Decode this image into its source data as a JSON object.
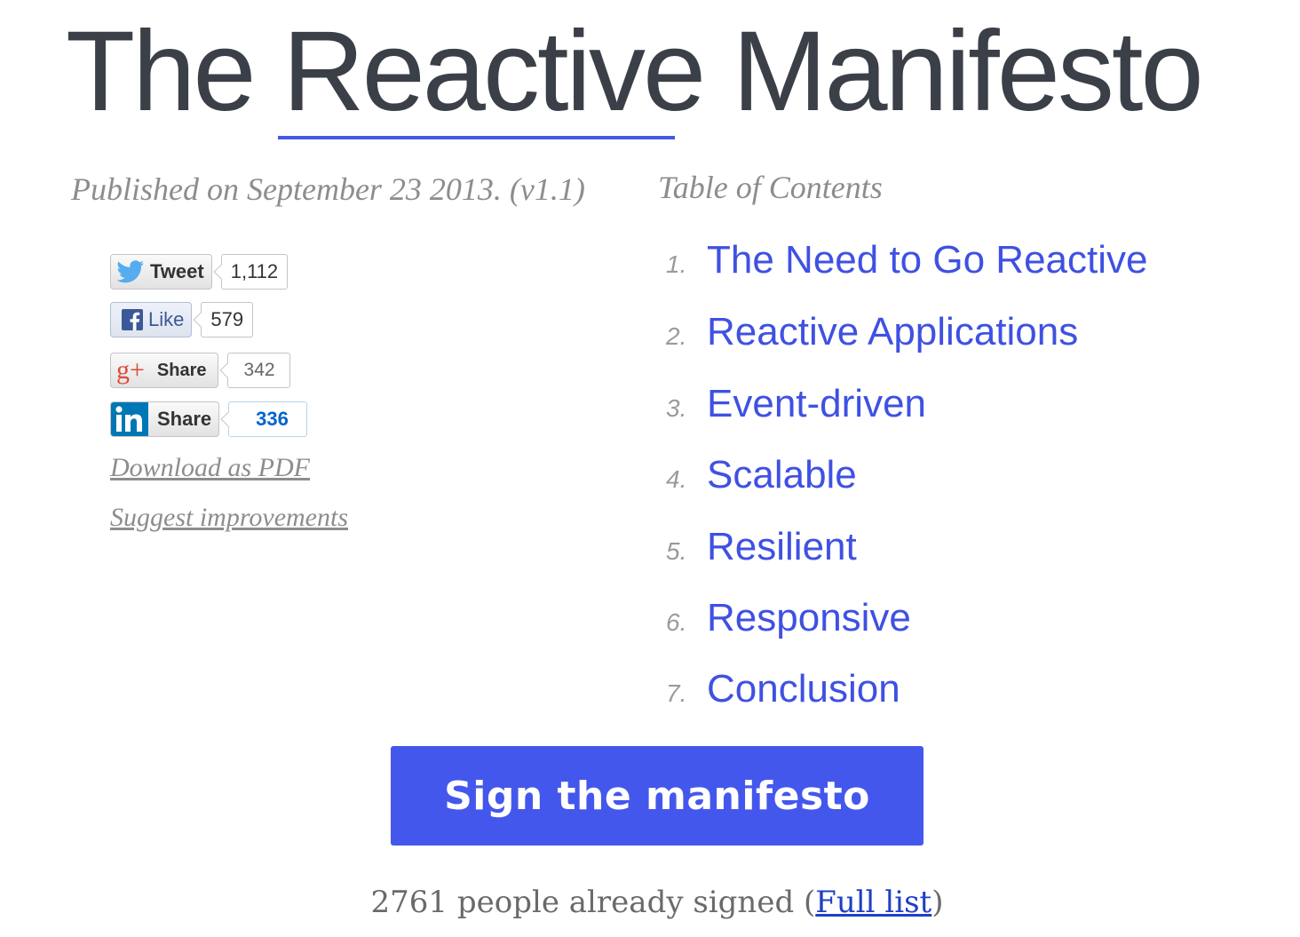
{
  "header": {
    "title_part1": "The ",
    "title_part2": "Reactive",
    "title_part3": " Manifesto"
  },
  "meta": {
    "published": "Published on September 23 2013. (v1.1)"
  },
  "toc": {
    "heading": "Table of Contents",
    "items": [
      {
        "num": "1.",
        "label": "The Need to Go Reactive"
      },
      {
        "num": "2.",
        "label": "Reactive Applications"
      },
      {
        "num": "3.",
        "label": "Event-driven"
      },
      {
        "num": "4.",
        "label": "Scalable"
      },
      {
        "num": "5.",
        "label": "Resilient"
      },
      {
        "num": "6.",
        "label": "Responsive"
      },
      {
        "num": "7.",
        "label": "Conclusion"
      }
    ]
  },
  "social": {
    "twitter": {
      "label": "Tweet",
      "count": "1,112",
      "icon": "twitter-bird-icon",
      "color": "#55acee"
    },
    "facebook": {
      "label": "Like",
      "count": "579",
      "icon": "facebook-icon",
      "color": "#3b5998"
    },
    "googleplus": {
      "label": "Share",
      "count": "342",
      "icon": "google-plus-icon",
      "color": "#dd4b39"
    },
    "linkedin": {
      "label": "Share",
      "count": "336",
      "icon": "linkedin-icon",
      "color": "#0077b5"
    }
  },
  "links": {
    "download_pdf": "Download as PDF",
    "suggest": "Suggest improvements"
  },
  "cta": {
    "sign_label": "Sign the manifesto",
    "signed_text": "2761 people already signed (",
    "full_list": "Full list",
    "signed_close": ")"
  },
  "colors": {
    "accent": "#4457ec",
    "link": "#3f51e2",
    "muted": "#8d8d8d"
  }
}
